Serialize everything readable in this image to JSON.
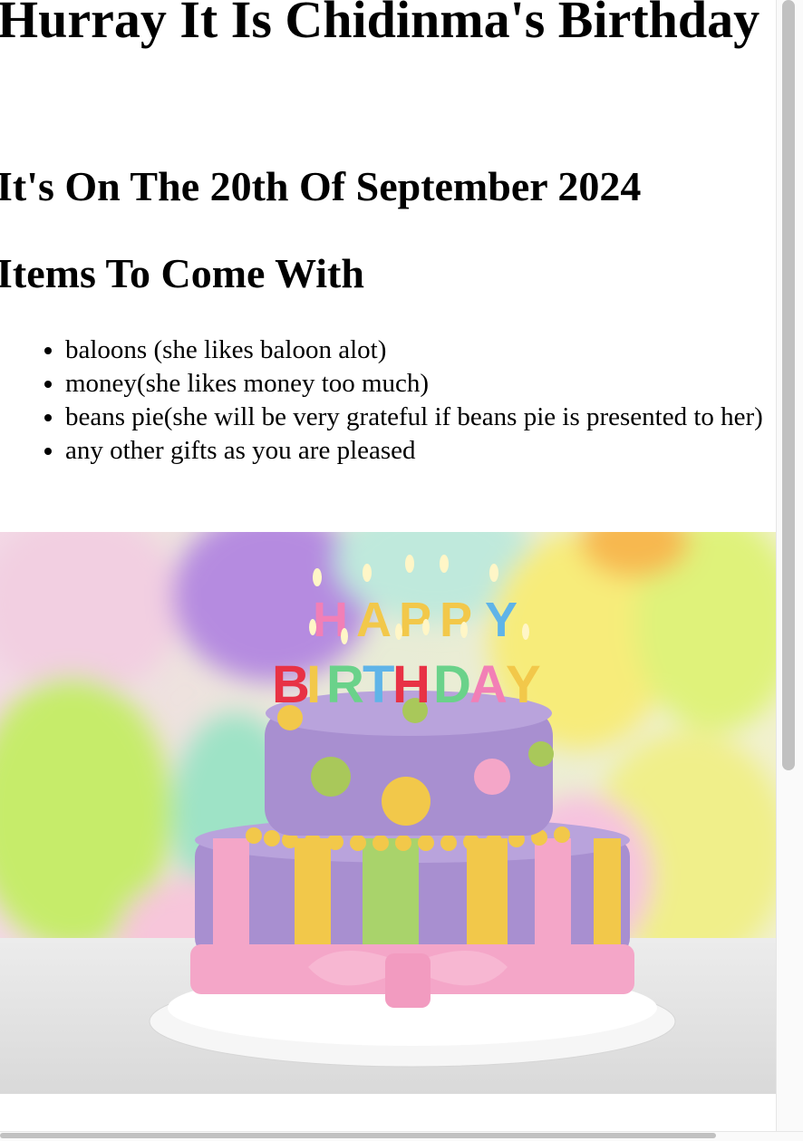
{
  "page": {
    "title": "Hurray It Is Chidinma's Birthday",
    "date_heading": "It's On The 20th Of September 2024",
    "items_heading": "Items To Come With",
    "items": [
      "baloons (she likes baloon alot)",
      "money(she likes money too much)",
      "beans pie(she will be very grateful if beans pie is presented to her)",
      "any other gifts as you are pleased"
    ]
  },
  "image": {
    "description_icon": "birthday-cake-image",
    "candles_top": [
      "H",
      "A",
      "P",
      "P",
      "Y"
    ],
    "candles_bottom": [
      "B",
      "I",
      "R",
      "T",
      "H",
      "D",
      "A",
      "Y"
    ],
    "colors": {
      "cake_purple": "#a88fd0",
      "pink": "#f4a6c8",
      "green": "#a9d36b",
      "yellow": "#f2c84a"
    }
  }
}
